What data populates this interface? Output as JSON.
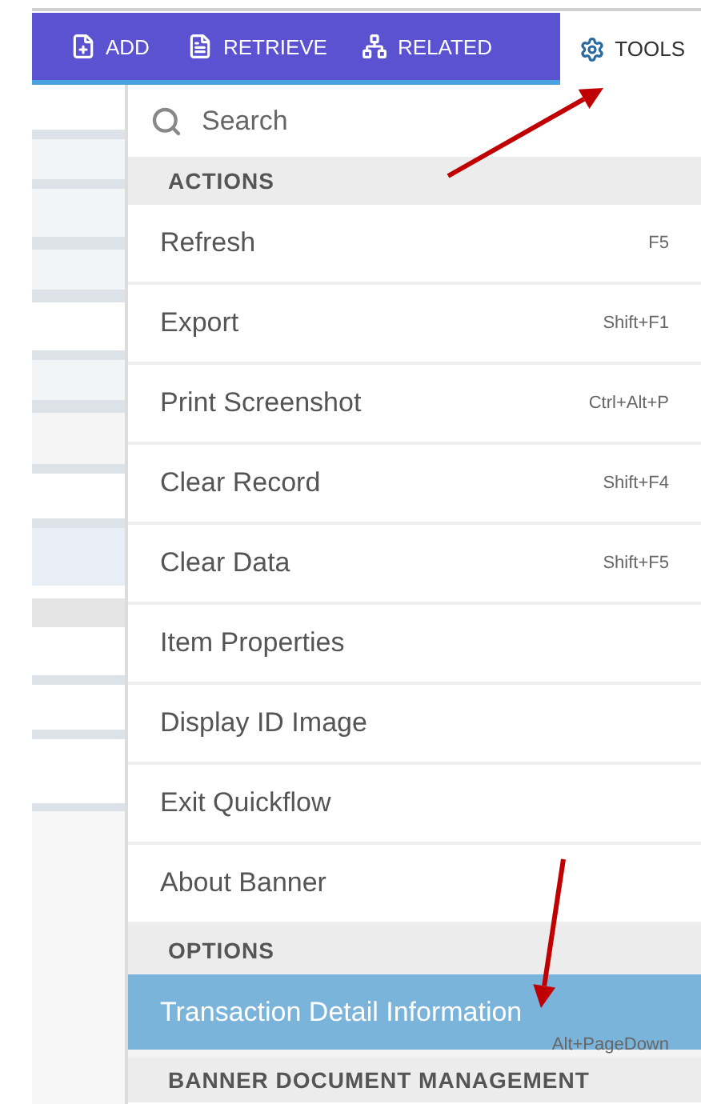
{
  "toolbar": {
    "items": [
      {
        "label": "ADD",
        "selected": false
      },
      {
        "label": "RETRIEVE",
        "selected": false
      },
      {
        "label": "RELATED",
        "selected": false
      },
      {
        "label": "TOOLS",
        "selected": true
      }
    ]
  },
  "menu": {
    "search": {
      "placeholder": "Search"
    },
    "sections": [
      {
        "title": "ACTIONS",
        "items": [
          {
            "label": "Refresh",
            "shortcut": "F5",
            "selected": false
          },
          {
            "label": "Export",
            "shortcut": "Shift+F1",
            "selected": false
          },
          {
            "label": "Print Screenshot",
            "shortcut": "Ctrl+Alt+P",
            "selected": false
          },
          {
            "label": "Clear Record",
            "shortcut": "Shift+F4",
            "selected": false
          },
          {
            "label": "Clear Data",
            "shortcut": "Shift+F5",
            "selected": false
          },
          {
            "label": "Item Properties",
            "selected": false
          },
          {
            "label": "Display ID Image",
            "selected": false
          },
          {
            "label": "Exit Quickflow",
            "selected": false
          },
          {
            "label": "About Banner",
            "selected": false
          }
        ]
      },
      {
        "title": "OPTIONS",
        "items": [
          {
            "label": "Transaction Detail Information",
            "shortcut": "Alt+PageDown",
            "selected": true
          }
        ]
      },
      {
        "title": "BANNER DOCUMENT MANAGEMENT"
      }
    ]
  }
}
